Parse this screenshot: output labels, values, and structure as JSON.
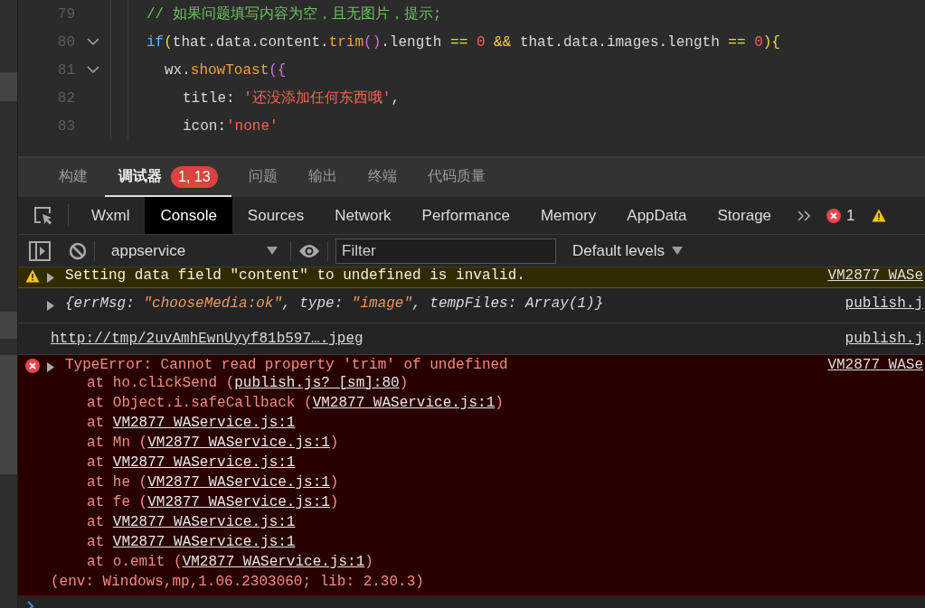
{
  "editor": {
    "lines": [
      {
        "number": "79",
        "tokens": [
          {
            "text": "// 如果问题填写内容为空，且无图片，提示;",
            "kind": "comment"
          }
        ]
      },
      {
        "number": "80",
        "expanded": true,
        "tokens": [
          {
            "text": "if",
            "kind": "kw"
          },
          {
            "text": "(",
            "kind": "op"
          },
          {
            "text": "that.data.content.",
            "kind": "plain"
          },
          {
            "text": "trim",
            "kind": "fn"
          },
          {
            "text": "()",
            "kind": "paren"
          },
          {
            "text": ".length ",
            "kind": "plain"
          },
          {
            "text": "== ",
            "kind": "op"
          },
          {
            "text": "0 ",
            "kind": "num"
          },
          {
            "text": "&& ",
            "kind": "op"
          },
          {
            "text": "that.data.images.length ",
            "kind": "plain"
          },
          {
            "text": "== ",
            "kind": "op"
          },
          {
            "text": "0",
            "kind": "num"
          },
          {
            "text": "){",
            "kind": "op"
          }
        ],
        "children": [
          {
            "number": "81",
            "expanded": true,
            "tokens": [
              {
                "text": "wx.",
                "kind": "plain"
              },
              {
                "text": "showToast",
                "kind": "fn"
              },
              {
                "text": "({",
                "kind": "paren"
              }
            ],
            "children": [
              {
                "number": "82",
                "tokens": [
                  {
                    "text": "title: ",
                    "kind": "plain"
                  },
                  {
                    "text": "'还没添加任何东西哦'",
                    "kind": "str"
                  },
                  {
                    "text": ",",
                    "kind": "plain"
                  }
                ]
              },
              {
                "number": "83",
                "tokens": [
                  {
                    "text": "icon:",
                    "kind": "plain"
                  },
                  {
                    "text": "'none'",
                    "kind": "str"
                  }
                ]
              }
            ]
          }
        ]
      }
    ]
  },
  "panel_tabs": [
    {
      "label": "构建",
      "selected": false
    },
    {
      "label": "调试器",
      "selected": true,
      "badge": "1, 13"
    },
    {
      "label": "问题",
      "selected": false
    },
    {
      "label": "输出",
      "selected": false
    },
    {
      "label": "终端",
      "selected": false
    },
    {
      "label": "代码质量",
      "selected": false
    }
  ],
  "devtools_tabs": [
    {
      "label": "Wxml",
      "selected": false
    },
    {
      "label": "Console",
      "selected": true
    },
    {
      "label": "Sources",
      "selected": false
    },
    {
      "label": "Network",
      "selected": false
    },
    {
      "label": "Performance",
      "selected": false
    },
    {
      "label": "Memory",
      "selected": false
    },
    {
      "label": "AppData",
      "selected": false
    },
    {
      "label": "Storage",
      "selected": false
    }
  ],
  "error_count": "1",
  "toolbar": {
    "context": "appservice",
    "filter": {
      "placeholder": "Filter"
    },
    "levels": "Default levels"
  },
  "console": [
    {
      "kind": "warning",
      "expandable": true,
      "tokens": [
        {
          "text": "Setting data field \"content\" to undefined is invalid.",
          "kind": "plain"
        }
      ],
      "source": "VM2877 WASe"
    },
    {
      "kind": "log",
      "expandable": true,
      "italic": true,
      "tokens": [
        {
          "text": "{errMsg: ",
          "kind": "plain"
        },
        {
          "text": "\"chooseMedia:ok\"",
          "kind": "str"
        },
        {
          "text": ", type: ",
          "kind": "plain"
        },
        {
          "text": "\"image\"",
          "kind": "str"
        },
        {
          "text": ", tempFiles: Array(1)}",
          "kind": "plain"
        }
      ],
      "source": "publish.j"
    },
    {
      "kind": "link",
      "expandable": false,
      "tokens": [
        {
          "text": "http://tmp/2uvAmhEwnUyyf81b597….jpeg",
          "kind": "plain"
        }
      ],
      "source": "publish.j"
    },
    {
      "kind": "error",
      "expandable": true,
      "tokens": [
        {
          "text": "TypeError: Cannot read property 'trim' of undefined",
          "kind": "plain"
        }
      ],
      "source": "VM2877 WASe",
      "stack": [
        [
          {
            "text": "at ho.clickSend (",
            "link": false
          },
          {
            "text": "publish.js? [sm]:80",
            "link": true
          },
          {
            "text": ")",
            "link": false
          }
        ],
        [
          {
            "text": "at Object.i.safeCallback (",
            "link": false
          },
          {
            "text": "VM2877 WAService.js:1",
            "link": true
          },
          {
            "text": ")",
            "link": false
          }
        ],
        [
          {
            "text": "at ",
            "link": false
          },
          {
            "text": "VM2877 WAService.js:1",
            "link": true
          }
        ],
        [
          {
            "text": "at Mn (",
            "link": false
          },
          {
            "text": "VM2877 WAService.js:1",
            "link": true
          },
          {
            "text": ")",
            "link": false
          }
        ],
        [
          {
            "text": "at ",
            "link": false
          },
          {
            "text": "VM2877 WAService.js:1",
            "link": true
          }
        ],
        [
          {
            "text": "at he (",
            "link": false
          },
          {
            "text": "VM2877 WAService.js:1",
            "link": true
          },
          {
            "text": ")",
            "link": false
          }
        ],
        [
          {
            "text": "at fe (",
            "link": false
          },
          {
            "text": "VM2877 WAService.js:1",
            "link": true
          },
          {
            "text": ")",
            "link": false
          }
        ],
        [
          {
            "text": "at ",
            "link": false
          },
          {
            "text": "VM2877 WAService.js:1",
            "link": true
          }
        ],
        [
          {
            "text": "at ",
            "link": false
          },
          {
            "text": "VM2877 WAService.js:1",
            "link": true
          }
        ],
        [
          {
            "text": "at o.emit (",
            "link": false
          },
          {
            "text": "VM2877 WAService.js:1",
            "link": true
          },
          {
            "text": ")",
            "link": false
          }
        ]
      ],
      "footer": "(env: Windows,mp,1.06.2303060; lib: 2.30.3)"
    }
  ]
}
